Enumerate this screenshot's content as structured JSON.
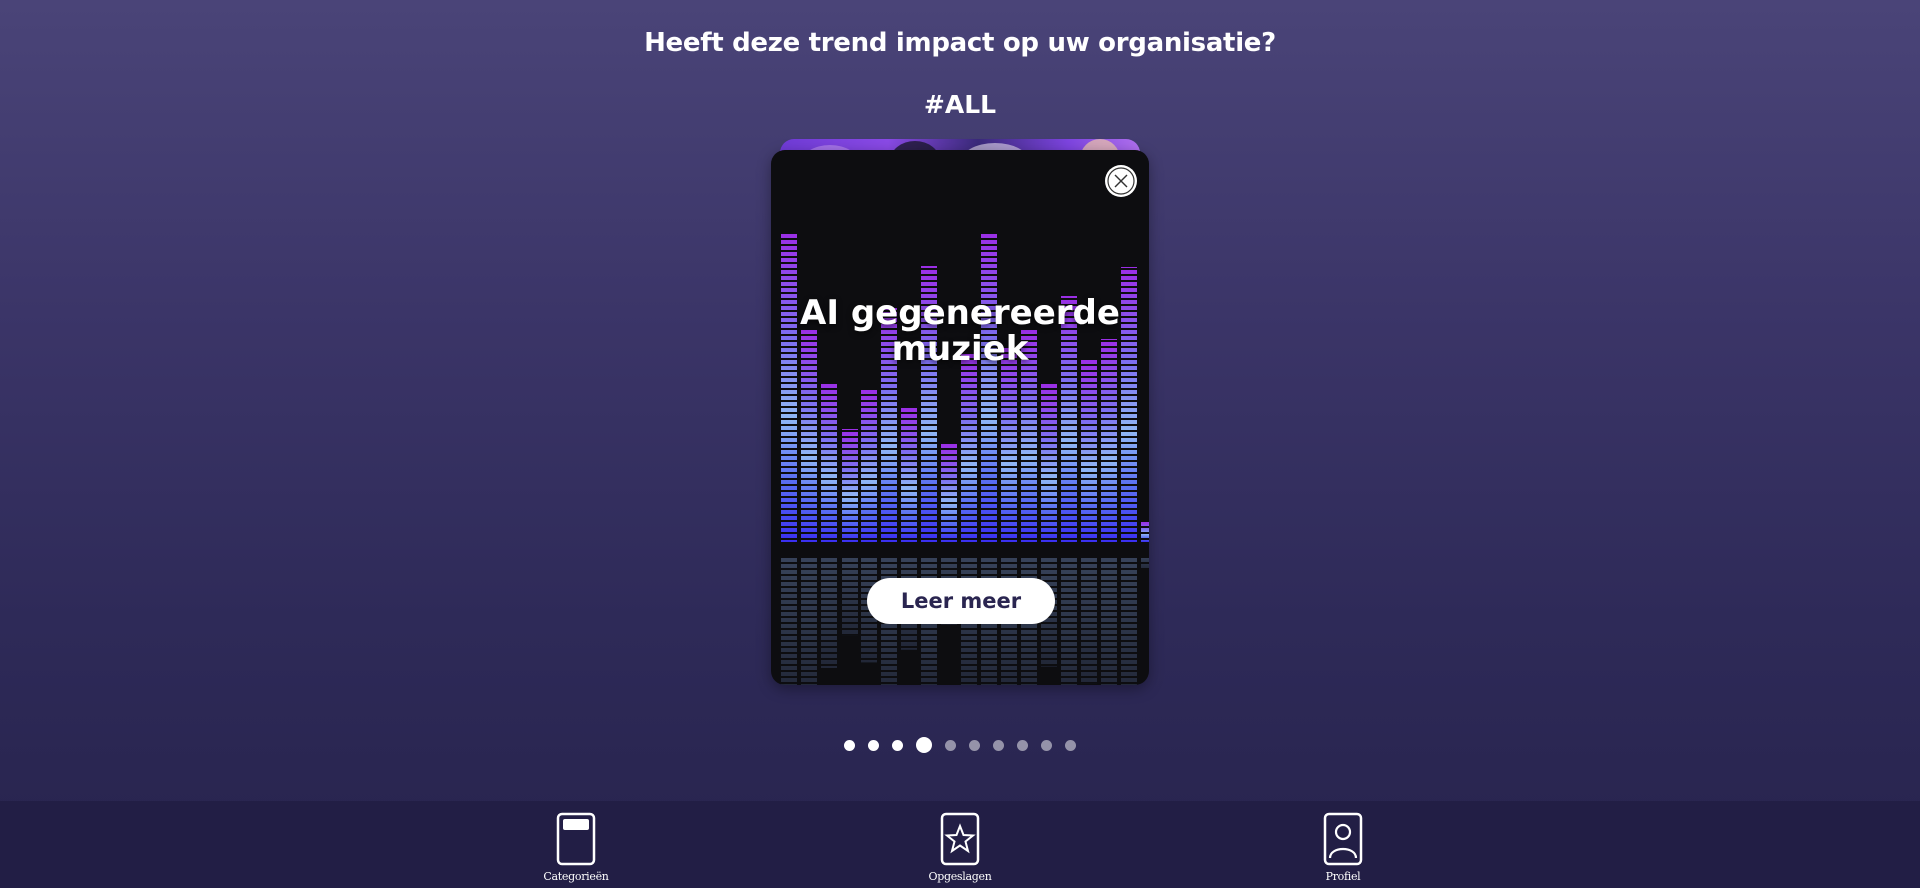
{
  "page": {
    "question": "Heeft deze trend impact op uw organisatie?",
    "hashtag": "#ALL"
  },
  "card": {
    "title": "AI gegenereerde muziek",
    "learn_more_label": "Leer meer",
    "close_icon": "close-icon"
  },
  "pagination": {
    "total": 10,
    "current": 4
  },
  "nav": {
    "items": [
      {
        "label": "Categorieën",
        "icon": "categories-icon"
      },
      {
        "label": "Opgeslagen",
        "icon": "star-icon"
      },
      {
        "label": "Profiel",
        "icon": "profile-icon"
      }
    ]
  },
  "colors": {
    "background_top": "#4a4478",
    "background_bottom": "#27234d",
    "nav_background": "#221e45",
    "card_background": "#0d0d10",
    "accent_purple": "#8a2be2",
    "accent_blue": "#3b3bf0"
  }
}
